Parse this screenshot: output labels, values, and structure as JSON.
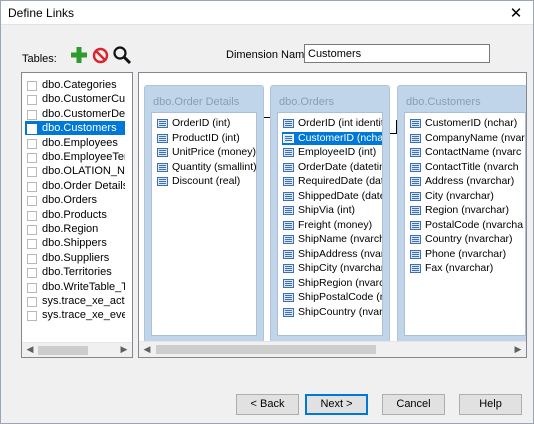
{
  "window": {
    "title": "Define Links",
    "close_glyph": "✕"
  },
  "toolbar": {
    "tables_label": "Tables:",
    "add_icon": "plus-icon",
    "remove_icon": "no-entry-icon",
    "search_icon": "magnifier-icon"
  },
  "dimension": {
    "label": "Dimension Name:",
    "value": "Customers"
  },
  "tables": [
    {
      "label": "dbo.Categories",
      "selected": false
    },
    {
      "label": "dbo.CustomerCustom",
      "selected": false
    },
    {
      "label": "dbo.CustomerDemog",
      "selected": false
    },
    {
      "label": "dbo.Customers",
      "selected": true
    },
    {
      "label": "dbo.Employees",
      "selected": false
    },
    {
      "label": "dbo.EmployeeTerrito",
      "selected": false
    },
    {
      "label": "dbo.OLATION_North",
      "selected": false
    },
    {
      "label": "dbo.Order Details",
      "selected": false
    },
    {
      "label": "dbo.Orders",
      "selected": false
    },
    {
      "label": "dbo.Products",
      "selected": false
    },
    {
      "label": "dbo.Region",
      "selected": false
    },
    {
      "label": "dbo.Shippers",
      "selected": false
    },
    {
      "label": "dbo.Suppliers",
      "selected": false
    },
    {
      "label": "dbo.Territories",
      "selected": false
    },
    {
      "label": "dbo.WriteTable_Tes",
      "selected": false
    },
    {
      "label": "sys.trace_xe_action_",
      "selected": false
    },
    {
      "label": "sys.trace_xe_event_",
      "selected": false
    }
  ],
  "entities": [
    {
      "name": "dbo.Order Details",
      "fields": [
        {
          "label": "OrderID (int)",
          "selected": false
        },
        {
          "label": "ProductID (int)",
          "selected": false
        },
        {
          "label": "UnitPrice (money)",
          "selected": false
        },
        {
          "label": "Quantity (smallint)",
          "selected": false
        },
        {
          "label": "Discount (real)",
          "selected": false
        }
      ]
    },
    {
      "name": "dbo.Orders",
      "fields": [
        {
          "label": "OrderID (int identity)",
          "selected": false
        },
        {
          "label": "CustomerID (nchar)",
          "selected": true
        },
        {
          "label": "EmployeeID (int)",
          "selected": false
        },
        {
          "label": "OrderDate (datetime)",
          "selected": false
        },
        {
          "label": "RequiredDate (dateti",
          "selected": false
        },
        {
          "label": "ShippedDate (datetin",
          "selected": false
        },
        {
          "label": "ShipVia (int)",
          "selected": false
        },
        {
          "label": "Freight (money)",
          "selected": false
        },
        {
          "label": "ShipName (nvarchar)",
          "selected": false
        },
        {
          "label": "ShipAddress (nvarch",
          "selected": false
        },
        {
          "label": "ShipCity (nvarchar)",
          "selected": false
        },
        {
          "label": "ShipRegion (nvarcha",
          "selected": false
        },
        {
          "label": "ShipPostalCode (nva",
          "selected": false
        },
        {
          "label": "ShipCountry (nvarcha",
          "selected": false
        }
      ]
    },
    {
      "name": "dbo.Customers",
      "fields": [
        {
          "label": "CustomerID (nchar)",
          "selected": false
        },
        {
          "label": "CompanyName (nvar",
          "selected": false
        },
        {
          "label": "ContactName (nvarc",
          "selected": false
        },
        {
          "label": "ContactTitle (nvarch",
          "selected": false
        },
        {
          "label": "Address (nvarchar)",
          "selected": false
        },
        {
          "label": "City (nvarchar)",
          "selected": false
        },
        {
          "label": "Region (nvarchar)",
          "selected": false
        },
        {
          "label": "PostalCode (nvarcha",
          "selected": false
        },
        {
          "label": "Country (nvarchar)",
          "selected": false
        },
        {
          "label": "Phone (nvarchar)",
          "selected": false
        },
        {
          "label": "Fax (nvarchar)",
          "selected": false
        }
      ]
    }
  ],
  "buttons": {
    "back": "< Back",
    "next": "Next >",
    "cancel": "Cancel",
    "help": "Help"
  },
  "colors": {
    "selection": "#0078d7",
    "entity_bg": "#c1d5ea",
    "plus": "#2e9b2e",
    "no_entry": "#d9262b"
  }
}
